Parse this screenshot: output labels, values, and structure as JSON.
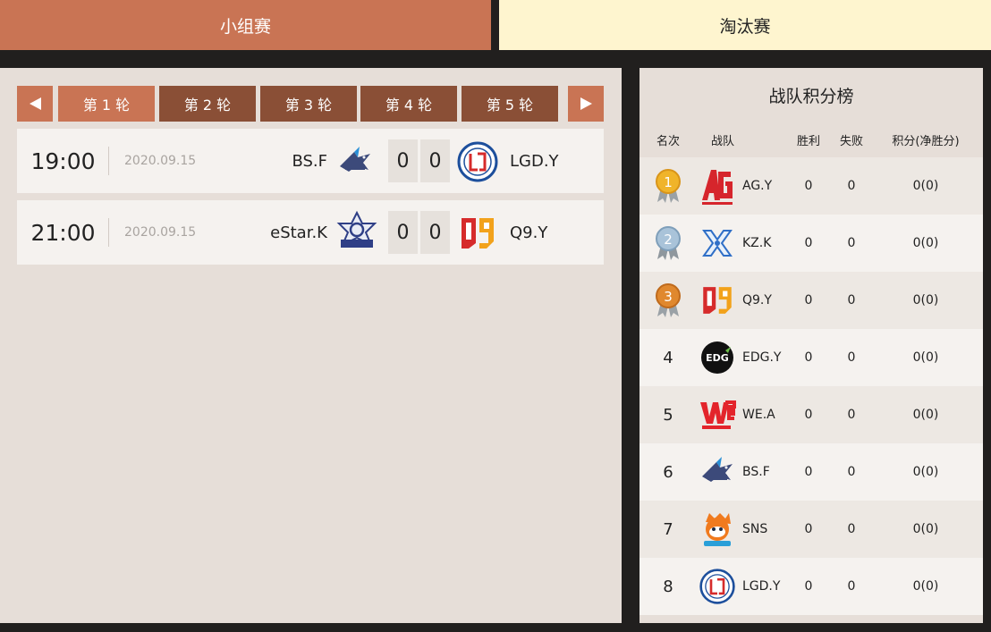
{
  "tabs": [
    {
      "label": "小组赛",
      "active": true
    },
    {
      "label": "淘汰赛",
      "active": false
    }
  ],
  "rounds": [
    "第 1 轮",
    "第 2 轮",
    "第 3 轮",
    "第 4 轮",
    "第 5 轮"
  ],
  "selected_round": 0,
  "matches": [
    {
      "time": "19:00",
      "date": "2020.09.15",
      "team1": "BS.F",
      "team1_logo": "bs-shark-logo",
      "score1": "0",
      "score2": "0",
      "team2": "LGD.Y",
      "team2_logo": "lgd-logo"
    },
    {
      "time": "21:00",
      "date": "2020.09.15",
      "team1": "eStar.K",
      "team1_logo": "estar-logo",
      "score1": "0",
      "score2": "0",
      "team2": "Q9.Y",
      "team2_logo": "q9-logo"
    }
  ],
  "standings": {
    "title": "战队积分榜",
    "headers": {
      "rank": "名次",
      "team": "战队",
      "wins": "胜利",
      "losses": "失败",
      "points": "积分(净胜分)"
    },
    "rows": [
      {
        "rank": "1",
        "medal": "gold",
        "team": "AG.Y",
        "logo": "ag-logo",
        "wins": "0",
        "losses": "0",
        "points": "0(0)"
      },
      {
        "rank": "2",
        "medal": "silver",
        "team": "KZ.K",
        "logo": "kz-logo",
        "wins": "0",
        "losses": "0",
        "points": "0(0)"
      },
      {
        "rank": "3",
        "medal": "bronze",
        "team": "Q9.Y",
        "logo": "q9-logo",
        "wins": "0",
        "losses": "0",
        "points": "0(0)"
      },
      {
        "rank": "4",
        "medal": "",
        "team": "EDG.Y",
        "logo": "edg-logo",
        "wins": "0",
        "losses": "0",
        "points": "0(0)"
      },
      {
        "rank": "5",
        "medal": "",
        "team": "WE.A",
        "logo": "we-logo",
        "wins": "0",
        "losses": "0",
        "points": "0(0)"
      },
      {
        "rank": "6",
        "medal": "",
        "team": "BS.F",
        "logo": "bs-shark-logo",
        "wins": "0",
        "losses": "0",
        "points": "0(0)"
      },
      {
        "rank": "7",
        "medal": "",
        "team": "SNS",
        "logo": "sns-logo",
        "wins": "0",
        "losses": "0",
        "points": "0(0)"
      },
      {
        "rank": "8",
        "medal": "",
        "team": "LGD.Y",
        "logo": "lgd-logo",
        "wins": "0",
        "losses": "0",
        "points": "0(0)"
      }
    ]
  },
  "colors": {
    "accent": "#c97454",
    "round_dark": "#8a4f36",
    "tab_inactive": "#fef5cf",
    "panel": "#e6ded8",
    "page_bg": "#211f1e"
  }
}
